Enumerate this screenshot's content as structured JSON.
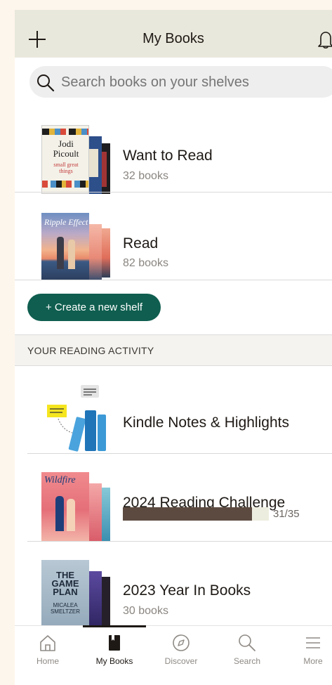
{
  "header": {
    "title": "My Books"
  },
  "search": {
    "placeholder": "Search books on your shelves"
  },
  "shelves": [
    {
      "name": "Want to Read",
      "count": "32 books"
    },
    {
      "name": "Read",
      "count": "82 books"
    }
  ],
  "create_shelf_label": "+ Create a new shelf",
  "reading_activity": {
    "section_title": "YOUR READING ACTIVITY",
    "notes_label": "Kindle Notes & Highlights",
    "challenge": {
      "title": "2024 Reading Challenge",
      "progress_text": "31/35",
      "progress_fraction": 0.886
    },
    "year_in_books": {
      "title": "2023 Year In Books",
      "count": "30 books"
    }
  },
  "cover_text": {
    "want_author": "Jodi\nPicoult",
    "want_title": "small great\nthings",
    "read_title": "Ripple Effect",
    "challenge_cover": "Wildfire",
    "year_cover": "THE\nGAME\nPLAN",
    "year_author": "MICALEA\nSMELTZER"
  },
  "tabs": [
    {
      "label": "Home",
      "icon": "home-icon"
    },
    {
      "label": "My Books",
      "icon": "book-icon",
      "active": true
    },
    {
      "label": "Discover",
      "icon": "compass-icon"
    },
    {
      "label": "Search",
      "icon": "search-icon"
    },
    {
      "label": "More",
      "icon": "menu-icon"
    }
  ],
  "colors": {
    "accent_green": "#0f5e4f",
    "progress_brown": "#5c4a40",
    "header_bg": "#e9e8dc"
  }
}
